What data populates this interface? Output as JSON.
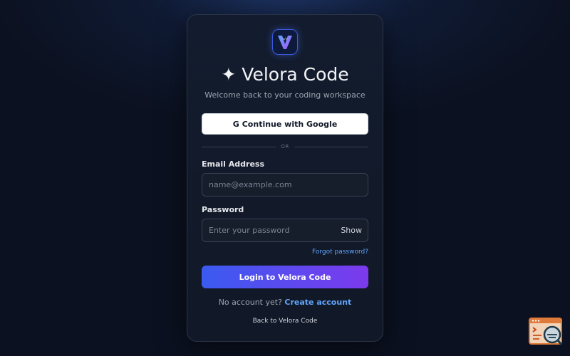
{
  "brand": {
    "logo_icon": "velora-v-logo-icon",
    "sparkle": "✦",
    "title": "Velora Code",
    "subtitle": "Welcome back to your coding workspace"
  },
  "oauth": {
    "google_glyph": "G",
    "google_label": "Continue with Google"
  },
  "divider": {
    "text": "OR"
  },
  "email": {
    "label": "Email Address",
    "value": "",
    "placeholder": "name@example.com"
  },
  "password": {
    "label": "Password",
    "value": "",
    "placeholder": "Enter your password",
    "toggle_label": "Show"
  },
  "links": {
    "forgot": "Forgot password?",
    "no_account": "No account yet?",
    "create_account": "Create account",
    "back": "Back to Velora Code"
  },
  "actions": {
    "login_label": "Login to Velora Code"
  },
  "widget": {
    "icon": "terminal-search-icon"
  },
  "colors": {
    "accent_blue": "#60a5fa",
    "button_gradient_start": "#3b5bf0",
    "button_gradient_end": "#7c3aed",
    "card_bg": "#111827",
    "page_bg": "#0b1120"
  }
}
